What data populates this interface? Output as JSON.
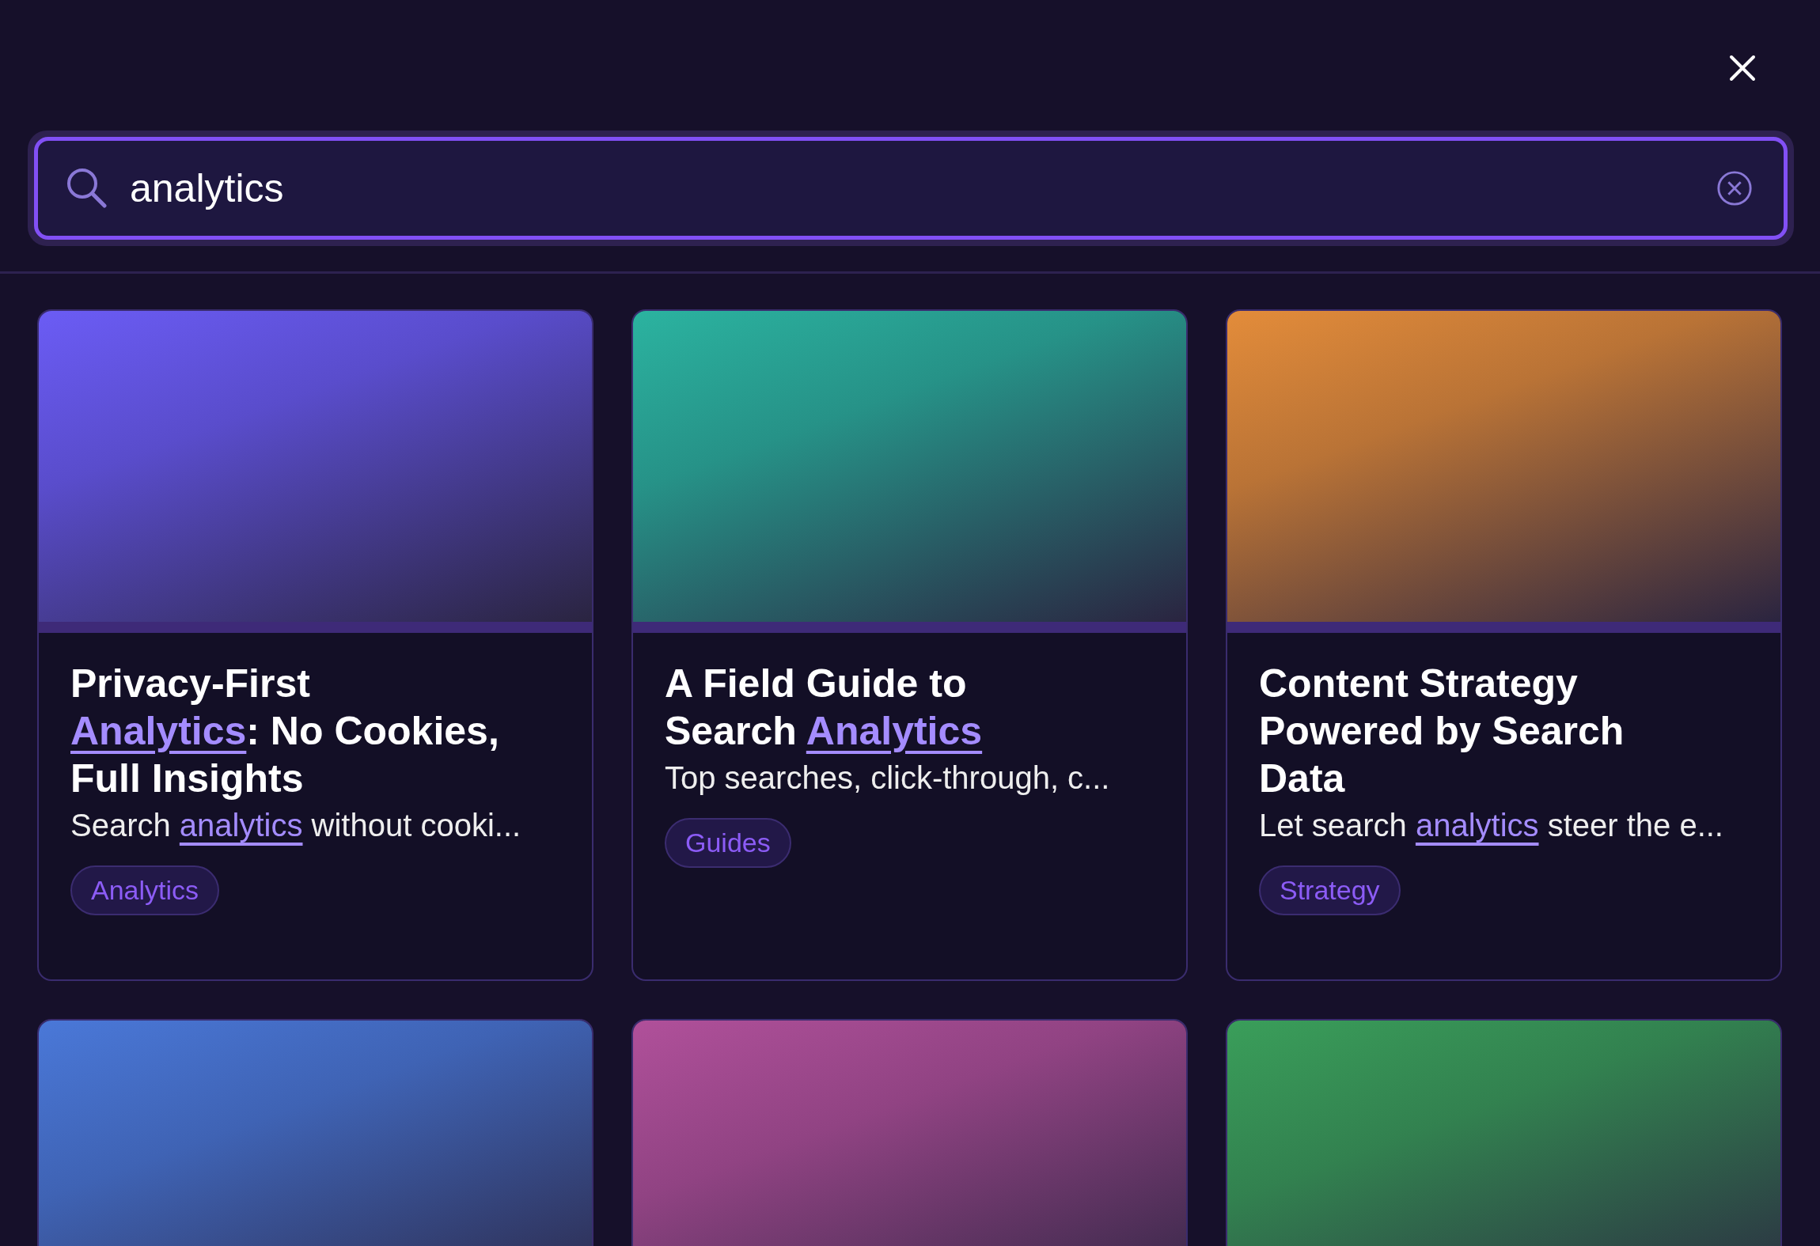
{
  "search": {
    "value": "analytics"
  },
  "results": [
    {
      "color": "#6b5cf5",
      "title": [
        {
          "text": "Privacy-First ",
          "highlight": false
        },
        {
          "text": "Analytics",
          "highlight": true
        },
        {
          "text": ": No Cookies, Full Insights",
          "highlight": false
        }
      ],
      "excerpt": [
        {
          "text": "Search ",
          "highlight": false
        },
        {
          "text": "analytics",
          "highlight": true
        },
        {
          "text": " without cooki...",
          "highlight": false
        }
      ],
      "tag": "Analytics"
    },
    {
      "color": "#2bb3a0",
      "title": [
        {
          "text": "A Field Guide to Search ",
          "highlight": false
        },
        {
          "text": "Analytics",
          "highlight": true
        }
      ],
      "excerpt": [
        {
          "text": "Top searches, click-through, c...",
          "highlight": false
        }
      ],
      "tag": "Guides"
    },
    {
      "color": "#e38c3a",
      "title": [
        {
          "text": "Content Strategy Powered by Search Data",
          "highlight": false
        }
      ],
      "excerpt": [
        {
          "text": "Let search ",
          "highlight": false
        },
        {
          "text": "analytics",
          "highlight": true
        },
        {
          "text": " steer the e...",
          "highlight": false
        }
      ],
      "tag": "Strategy"
    },
    {
      "color": "#4a78d8"
    },
    {
      "color": "#b0509a"
    },
    {
      "color": "#3a9e5a"
    }
  ]
}
